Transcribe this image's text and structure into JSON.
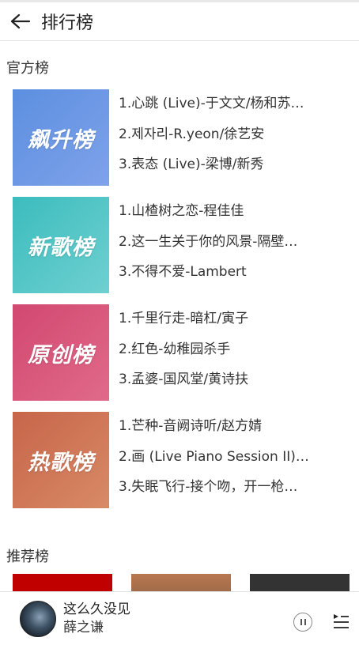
{
  "header": {
    "title": "排行榜"
  },
  "official_section": {
    "title": "官方榜"
  },
  "official_charts": [
    {
      "cover_text": "飙升榜",
      "tracks": [
        "1.心跳 (Live)-于文文/杨和苏…",
        "2.제자리-R.yeon/徐艺安",
        "3.表态 (Live)-梁博/新秀"
      ]
    },
    {
      "cover_text": "新歌榜",
      "tracks": [
        "1.山楂树之恋-程佳佳",
        "2.这一生关于你的风景-隔壁…",
        "3.不得不爱-Lambert"
      ]
    },
    {
      "cover_text": "原创榜",
      "tracks": [
        "1.千里行走-暗杠/寅子",
        "2.红色-幼稚园杀手",
        "3.孟婆-国风堂/黄诗扶"
      ]
    },
    {
      "cover_text": "热歌榜",
      "tracks": [
        "1.芒种-音阙诗听/赵方婧",
        "2.画 (Live Piano Session II)…",
        "3.失眠飞行-接个吻，开一枪…"
      ]
    }
  ],
  "recommend_section": {
    "title": "推荐榜"
  },
  "player": {
    "title": "这么久没见",
    "artist": "薛之谦"
  },
  "colors": {
    "soar": [
      "#5c8fe0",
      "#7fa2ea"
    ],
    "new": [
      "#3cbcbe",
      "#6fd0d0"
    ],
    "original": [
      "#d24870",
      "#e06a8a"
    ],
    "hot": [
      "#c7654a",
      "#d88a66"
    ],
    "rec": [
      "#c00000",
      "#b87850",
      "#333333"
    ]
  }
}
